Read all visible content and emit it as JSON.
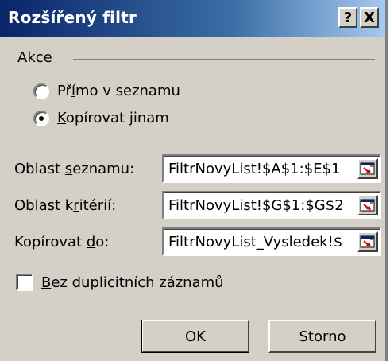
{
  "dialog": {
    "title": "Rozšířený filtr",
    "help_button": "?",
    "close_button": "X"
  },
  "action_group": {
    "label": "Akce",
    "option_in_place": {
      "pre": "Př",
      "key": "í",
      "post": "mo v seznamu",
      "selected": false
    },
    "option_copy": {
      "pre": "",
      "key": "K",
      "post": "opírovat jinam",
      "selected": true
    }
  },
  "fields": {
    "list_range": {
      "label_pre": "Oblast ",
      "label_key": "s",
      "label_post": "eznamu:",
      "value": "FiltrNovyList!$A$1:$E$1"
    },
    "criteria_range": {
      "label_pre": "Oblast k",
      "label_key": "r",
      "label_post": "itérií:",
      "value": "FiltrNovyList!$G$1:$G$2"
    },
    "copy_to": {
      "label_pre": "Kopírovat ",
      "label_key": "d",
      "label_post": "o:",
      "value": "FiltrNovyList_Vysledek!$"
    }
  },
  "unique_records": {
    "label_pre": "",
    "label_key": "B",
    "label_post": "ez duplicitních záznamů",
    "checked": false
  },
  "buttons": {
    "ok": "OK",
    "cancel": "Storno"
  },
  "icons": {
    "collapse": "range-selector-icon"
  }
}
